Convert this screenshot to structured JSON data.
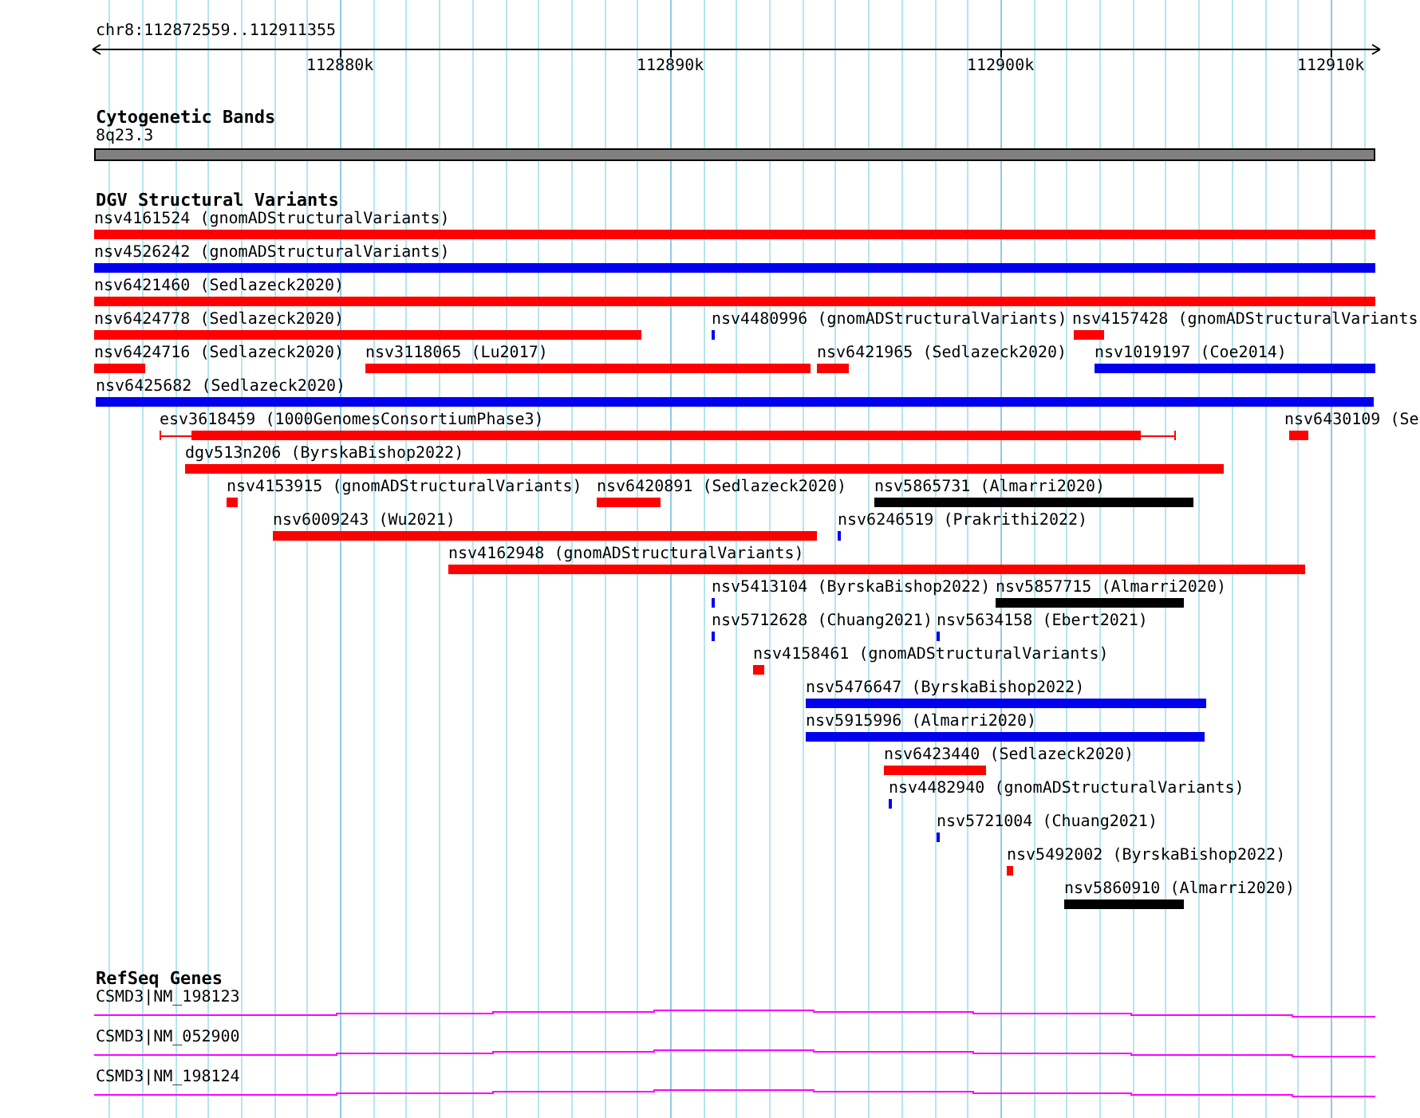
{
  "view": {
    "location": "chr8:112872559..112911355",
    "ticks": [
      "112880k",
      "112890k",
      "112900k",
      "112910k"
    ]
  },
  "cytoband_track": {
    "title": "Cytogenetic Bands",
    "bands": [
      {
        "name": "8q23.3"
      }
    ]
  },
  "dgv_track": {
    "title": "DGV Structural Variants",
    "rows": [
      {
        "features": [
          {
            "label": "nsv4161524 (gnomADStructuralVariants)",
            "color": "#ff0000"
          }
        ]
      },
      {
        "features": [
          {
            "label": "nsv4526242 (gnomADStructuralVariants)",
            "color": "#0000ee"
          }
        ]
      },
      {
        "features": [
          {
            "label": "nsv6421460 (Sedlazeck2020)",
            "color": "#ff0000"
          }
        ]
      },
      {
        "features": [
          {
            "label": "nsv6424778 (Sedlazeck2020)",
            "color": "#ff0000"
          },
          {
            "label": "nsv4480996 (gnomADStructuralVariants)",
            "color": "#0000ee"
          },
          {
            "label": "nsv4157428 (gnomADStructuralVariants",
            "color": "#ff0000"
          }
        ]
      },
      {
        "features": [
          {
            "label": "nsv6424716 (Sedlazeck2020)",
            "color": "#ff0000"
          },
          {
            "label": "nsv3118065 (Lu2017)",
            "color": "#ff0000"
          },
          {
            "label": "nsv6421965 (Sedlazeck2020)",
            "color": "#ff0000"
          },
          {
            "label": "nsv1019197 (Coe2014)",
            "color": "#0000ee"
          }
        ]
      },
      {
        "features": [
          {
            "label": "nsv6425682 (Sedlazeck2020)",
            "color": "#0000ee"
          }
        ]
      },
      {
        "features": [
          {
            "label": "esv3618459 (1000GenomesConsortiumPhase3)",
            "color": "#ff0000"
          },
          {
            "label": "nsv6430109 (Se",
            "color": "#ff0000"
          }
        ]
      },
      {
        "features": [
          {
            "label": "dgv513n206 (ByrskaBishop2022)",
            "color": "#ff0000"
          }
        ]
      },
      {
        "features": [
          {
            "label": "nsv4153915 (gnomADStructuralVariants)",
            "color": "#ff0000"
          },
          {
            "label": "nsv6420891 (Sedlazeck2020)",
            "color": "#ff0000"
          },
          {
            "label": "nsv5865731 (Almarri2020)",
            "color": "#000000"
          }
        ]
      },
      {
        "features": [
          {
            "label": "nsv6009243 (Wu2021)",
            "color": "#ff0000"
          },
          {
            "label": "nsv6246519 (Prakrithi2022)",
            "color": "#0000ee"
          }
        ]
      },
      {
        "features": [
          {
            "label": "nsv4162948 (gnomADStructuralVariants)",
            "color": "#ff0000"
          }
        ]
      },
      {
        "features": [
          {
            "label": "nsv5413104 (ByrskaBishop2022)",
            "color": "#0000ee"
          },
          {
            "label": "nsv5857715 (Almarri2020)",
            "color": "#000000"
          }
        ]
      },
      {
        "features": [
          {
            "label": "nsv5712628 (Chuang2021)",
            "color": "#0000ee"
          },
          {
            "label": "nsv5634158 (Ebert2021)",
            "color": "#0000ee"
          }
        ]
      },
      {
        "features": [
          {
            "label": "nsv4158461 (gnomADStructuralVariants)",
            "color": "#ff0000"
          }
        ]
      },
      {
        "features": [
          {
            "label": "nsv5476647 (ByrskaBishop2022)",
            "color": "#0000ee"
          }
        ]
      },
      {
        "features": [
          {
            "label": "nsv5915996 (Almarri2020)",
            "color": "#0000ee"
          }
        ]
      },
      {
        "features": [
          {
            "label": "nsv6423440 (Sedlazeck2020)",
            "color": "#ff0000"
          }
        ]
      },
      {
        "features": [
          {
            "label": "nsv4482940 (gnomADStructuralVariants)",
            "color": "#0000ee"
          }
        ]
      },
      {
        "features": [
          {
            "label": "nsv5721004 (Chuang2021)",
            "color": "#0000ee"
          }
        ]
      },
      {
        "features": [
          {
            "label": "nsv5492002 (ByrskaBishop2022)",
            "color": "#ff0000"
          }
        ]
      },
      {
        "features": [
          {
            "label": "nsv5860910 (Almarri2020)",
            "color": "#000000"
          }
        ]
      }
    ]
  },
  "refseq_track": {
    "title": "RefSeq Genes",
    "genes": [
      {
        "label": "CSMD3|NM_198123"
      },
      {
        "label": "CSMD3|NM_052900"
      },
      {
        "label": "CSMD3|NM_198124"
      }
    ]
  }
}
